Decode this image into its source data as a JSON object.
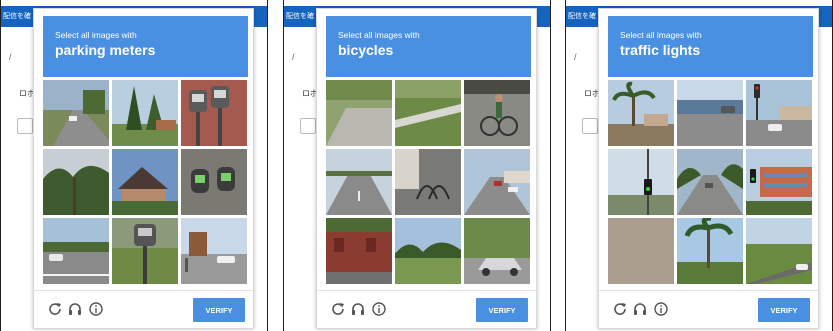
{
  "background_page": {
    "banner_text": "配信を確",
    "row_text": "ロボ"
  },
  "captchas": [
    {
      "prompt": "Select all images with",
      "target": "parking meters",
      "verify_label": "VERIFY",
      "tiles": [
        "street-road",
        "palm-trees",
        "parking-meter-closeup",
        "trees",
        "house-roof",
        "parking-meter-top",
        "road-cars",
        "parking-meter-grass",
        "street-sign"
      ]
    },
    {
      "prompt": "Select all images with",
      "target": "bicycles",
      "verify_label": "VERIFY",
      "tiles": [
        "sidewalk",
        "grass-slope",
        "bicycle-rider",
        "road",
        "bike-rack",
        "road-traffic",
        "brick-building",
        "trees-field",
        "car-driveway"
      ]
    },
    {
      "prompt": "Select all images with",
      "target": "traffic lights",
      "verify_label": "VERIFY",
      "tiles": [
        "palm-trees",
        "highway-water",
        "traffic-light-street",
        "traffic-light-pole",
        "road-trees",
        "traffic-light-building",
        "pavement",
        "palm-trees-sky",
        "grass-road"
      ]
    }
  ],
  "icons": {
    "reload": "reload-icon",
    "audio": "headphones-icon",
    "info": "info-icon"
  },
  "colors": {
    "accent": "#4a90e2",
    "banner": "#1565c0"
  }
}
